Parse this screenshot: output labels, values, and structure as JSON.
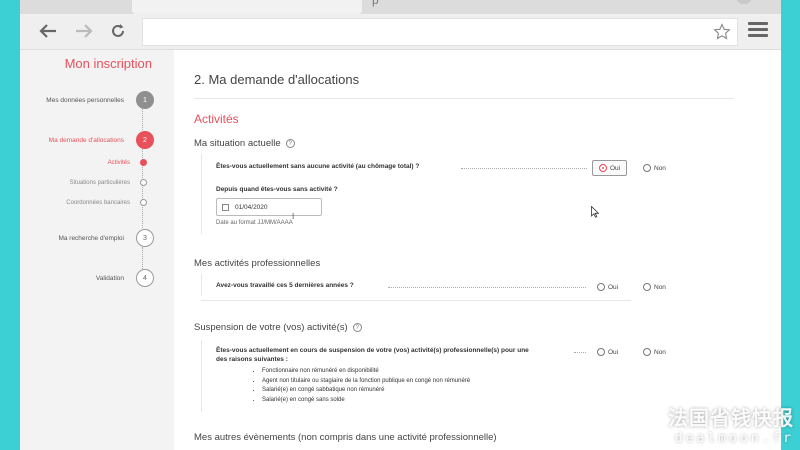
{
  "browser": {
    "tab_glyph": "p",
    "back_icon": "arrow-left-icon",
    "forward_icon": "arrow-right-icon",
    "reload_icon": "reload-icon",
    "star_icon": "star-icon",
    "menu_icon": "hamburger-menu-icon"
  },
  "sidebar": {
    "title": "Mon inscription",
    "steps": [
      {
        "label": "Mes données personnelles",
        "number": "1",
        "state": "done"
      },
      {
        "label": "Ma demande d'allocations",
        "number": "2",
        "state": "active"
      },
      {
        "label": "Ma recherche d'emploi",
        "number": "3",
        "state": "todo"
      },
      {
        "label": "Validation",
        "number": "4",
        "state": "todo"
      }
    ],
    "substeps": [
      {
        "label": "Activités",
        "current": true
      },
      {
        "label": "Situations particulières",
        "current": false
      },
      {
        "label": "Coordonnées bancaires",
        "current": false
      }
    ]
  },
  "main": {
    "title": "2. Ma demande d'allocations",
    "section": "Activités",
    "situation": {
      "title": "Ma situation actuelle",
      "help": "?",
      "question": "Êtes-vous actuellement sans aucune activité (au chômage total) ?",
      "yes": "Oui",
      "no": "Non",
      "since_question": "Depuis quand êtes-vous sans activité ?",
      "date_value": "01/04/2020",
      "date_hint": "Date au format JJ/MM/AAAA"
    },
    "pro": {
      "title": "Mes activités professionnelles",
      "question": "Avez-vous travaillé ces 5 dernières années ?",
      "yes": "Oui",
      "no": "Non"
    },
    "suspension": {
      "title": "Suspension de votre (vos) activité(s)",
      "help": "?",
      "question_line1": "Êtes-vous actuellement en cours de suspension de votre (vos) activité(s) professionnelle(s) pour une",
      "question_line2": "des raisons suivantes :",
      "yes": "Oui",
      "no": "Non",
      "reasons": [
        "Fonctionnaire non rémunéré en disponibilité",
        "Agent non titulaire ou stagiaire de la fonction publique en congé non rémunéré",
        "Salarié(e) en congé sabbatique non rémunéré",
        "Salarié(e) en congé sans solde"
      ]
    },
    "other_events": {
      "title": "Mes autres évènements (non compris dans une activité professionnelle)"
    }
  },
  "watermark": {
    "line1": "法国省钱快报",
    "line2": "dealmoon.fr"
  },
  "colors": {
    "accent": "#e8505b",
    "background": "#3ccfd4"
  }
}
